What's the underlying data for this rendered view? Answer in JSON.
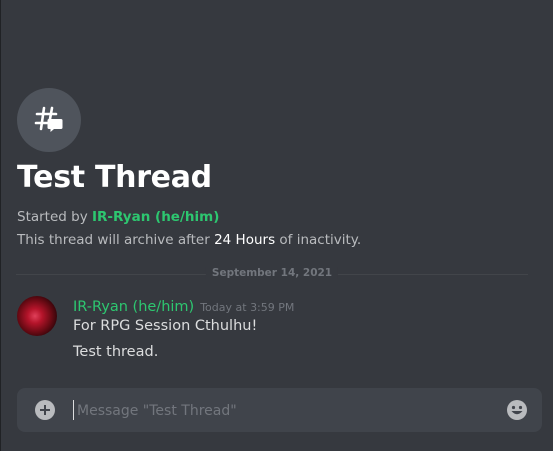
{
  "thread": {
    "title": "Test Thread",
    "started_by_prefix": "Started by ",
    "started_by_author": "IR-Ryan (he/him)",
    "archive_prefix": "This thread will archive after ",
    "archive_duration": "24 Hours",
    "archive_suffix": " of inactivity."
  },
  "divider": {
    "date": "September 14, 2021"
  },
  "message": {
    "author": "IR-Ryan (he/him)",
    "timestamp": "Today at 3:59 PM",
    "lines": [
      "For RPG Session Cthulhu!",
      "Test thread."
    ]
  },
  "composer": {
    "placeholder": "Message \"Test Thread\""
  },
  "icons": {
    "thread": "thread-icon",
    "add": "plus-circle-icon",
    "emoji": "smiley-icon"
  },
  "colors": {
    "background": "#36393f",
    "author": "#2dc770",
    "composer": "#40444b"
  }
}
